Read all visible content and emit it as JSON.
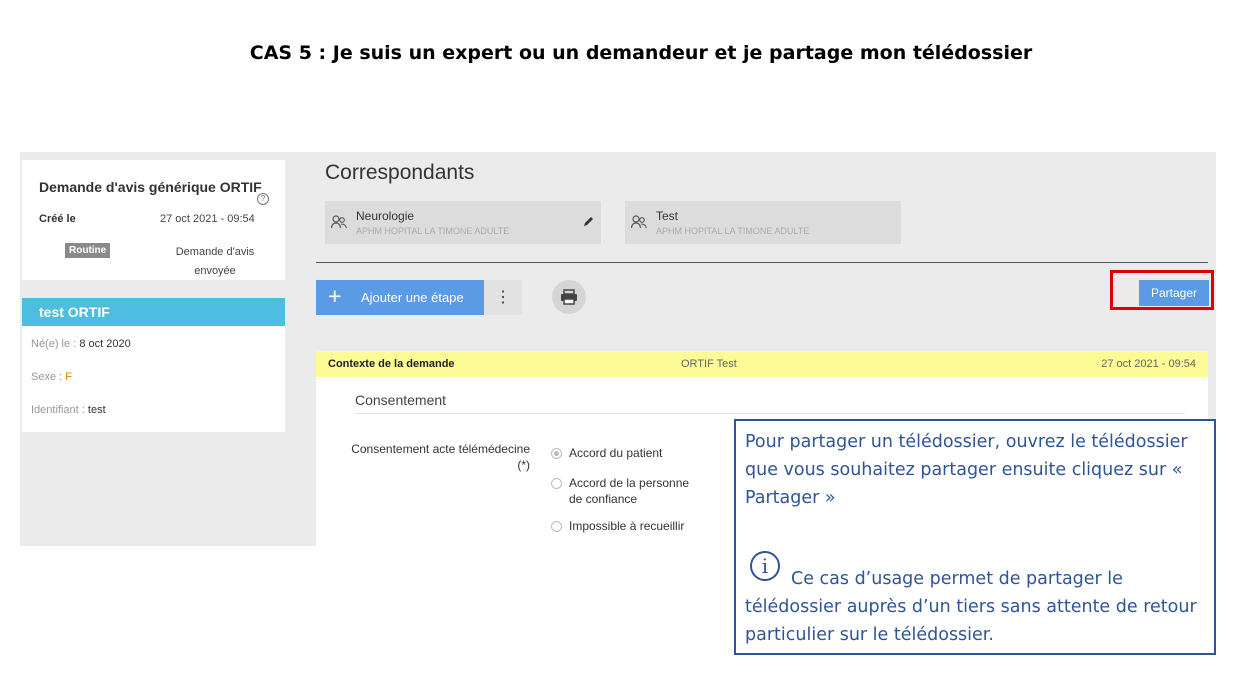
{
  "slide_title": "CAS 5 : Je suis un expert ou un demandeur et je partage mon télédossier",
  "request_card": {
    "title": "Demande d'avis générique ORTIF",
    "created_label": "Créé le",
    "created_value": "27 oct 2021 - 09:54",
    "help_icon": "?",
    "badge": "Routine",
    "status_line1": "Demande d'avis",
    "status_line2": "envoyée"
  },
  "patient_card": {
    "name": "test ORTIF",
    "birth_label": "Né(e) le :",
    "birth_value": "8 oct 2020",
    "sex_label": "Sexe :",
    "sex_value": "F",
    "id_label": "Identifiant :",
    "id_value": "test"
  },
  "main": {
    "title": "Correspondants",
    "correspondants": [
      {
        "name": "Neurologie",
        "sub": "APHM HOPITAL LA TIMONE ADULTE",
        "icon": "users-icon"
      },
      {
        "name": "Test",
        "sub": "APHM HOPITAL LA TIMONE ADULTE",
        "icon": "users-icon"
      }
    ],
    "add_step_label": "Ajouter une étape",
    "add_step_icon": "+",
    "more_icon": "⋮",
    "print_icon": "🖶",
    "share_label": "Partager"
  },
  "context_bar": {
    "left": "Contexte de la demande",
    "middle": "ORTIF Test",
    "right": "27 oct 2021 - 09:54"
  },
  "consent": {
    "section_title": "Consentement",
    "field_label_line1": "Consentement acte télémédecine",
    "field_label_line2": "(*)",
    "options": [
      {
        "label": "Accord du patient",
        "selected": true
      },
      {
        "label": "Accord de la personne de confiance",
        "selected": false
      },
      {
        "label": "Impossible à recueillir",
        "selected": false
      }
    ]
  },
  "callout": {
    "text1": "Pour partager un télédossier, ouvrez le télédossier que vous souhaitez partager ensuite cliquez sur « Partager »",
    "info_icon": "i",
    "text2": "Ce cas d’usage permet de partager le télédossier auprès d’un tiers sans attente de retour particulier sur le télédossier."
  },
  "colors": {
    "accent_blue": "#5b9be6",
    "patient_header": "#4dbedf",
    "highlight_red": "#e00000",
    "callout_blue": "#2f5597",
    "context_yellow": "#fdfb96"
  }
}
